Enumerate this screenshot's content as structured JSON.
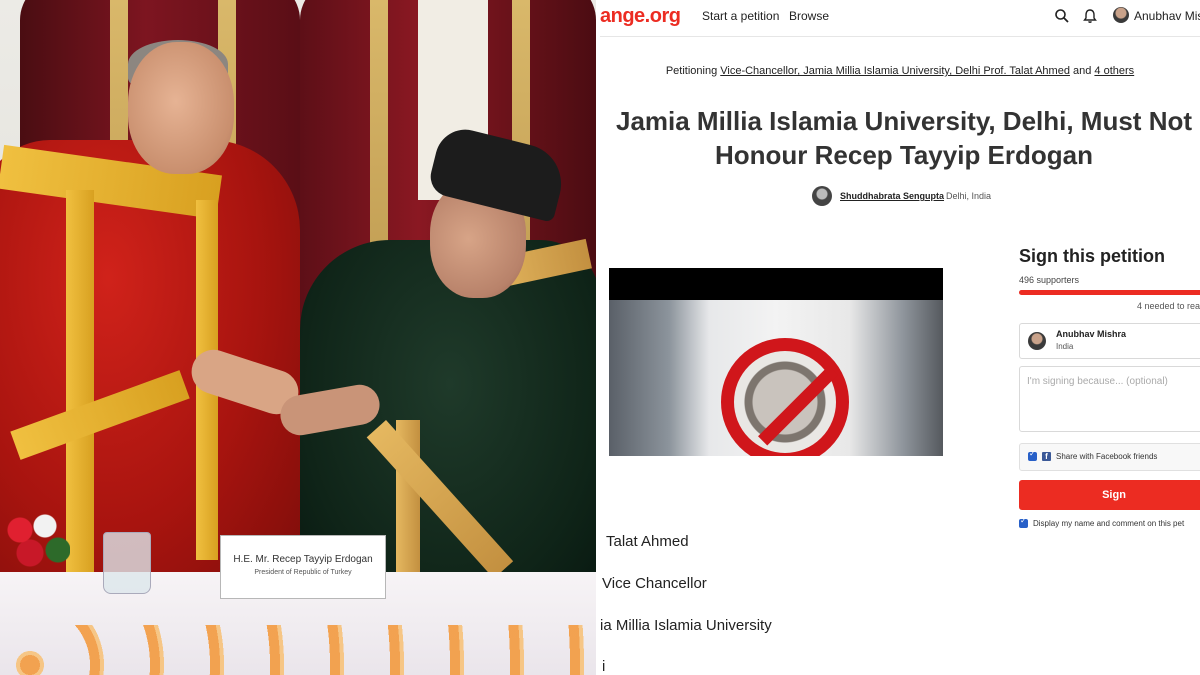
{
  "photo": {
    "nameplate_name": "H.E. Mr. Recep Tayyip Erdogan",
    "nameplate_subtitle": "President of Republic of Turkey"
  },
  "topbar": {
    "logo_text": "ange.org",
    "nav_start": "Start a petition",
    "nav_browse": "Browse",
    "icons": [
      "search-icon",
      "bell-icon"
    ],
    "user_name": "Anubhav Mis"
  },
  "petition": {
    "petitioning_prefix": "Petitioning ",
    "petitioning_target": "Vice-Chancellor, Jamia Millia Islamia University, Delhi Prof. Talat Ahmed",
    "petitioning_and": " and ",
    "petitioning_others": "4 others",
    "title_line1": "Jamia Millia Islamia University, Delhi, Must Not",
    "title_line2": "Honour Recep Tayyip Erdogan",
    "author_name": "Shuddhabrata Sengupta",
    "author_location": "Delhi, India"
  },
  "letter": {
    "line1": "Talat Ahmed",
    "line2": "Vice Chancellor",
    "line3": "ia Millia Islamia University",
    "line4": "i"
  },
  "sign": {
    "title": "Sign this petition",
    "supporters": "496 supporters",
    "progress": 0.98,
    "needed": "4 needed to rea",
    "signer_name": "Anubhav Mishra",
    "signer_location": "India",
    "reason_placeholder": "I'm signing because... (optional)",
    "share_facebook": "Share with Facebook friends",
    "button_label": "Sign",
    "display_label": "Display my name and comment on this pet"
  },
  "colors": {
    "brand_red": "#ec2c22",
    "checkbox_blue": "#2860c8",
    "facebook_blue": "#3b5998"
  }
}
